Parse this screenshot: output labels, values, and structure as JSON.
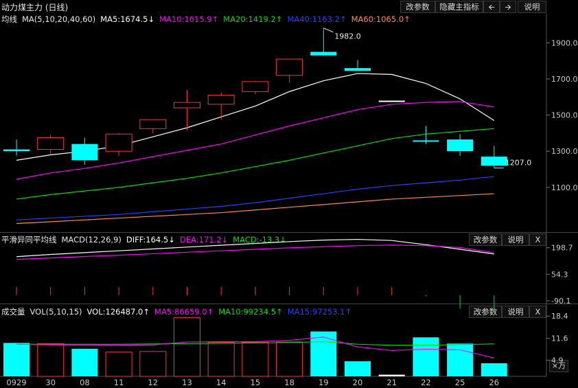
{
  "window": {
    "title": "动力煤主力 (日线)"
  },
  "toolbar": {
    "change_params": "改参数",
    "hide_indicator": "隐藏主指标",
    "prev_icon": "arrow-left-icon",
    "next_icon": "arrow-right-icon",
    "help": "说明"
  },
  "main_panel": {
    "label": "均线",
    "ma_spec": "MA(5,10,20,40,60)",
    "ma5": "MA5:1674.5↓",
    "ma10": "MA10:1615.9↑",
    "ma20": "MA20:1419.2↑",
    "ma40": "MA40:1163.2↑",
    "ma60": "MA60:1065.0↑",
    "high_note": "1982.0",
    "low_note": "1207.0",
    "yticks": [
      "1900.0",
      "1700.0",
      "1500.0",
      "1300.0",
      "1100.0"
    ]
  },
  "macd_panel": {
    "label": "平滑异同平均线",
    "spec": "MACD(12,26,9)",
    "diff": "DIFF:164.5↓",
    "dea": "DEA:171.2↓",
    "macd": "MACD:-13.3↓",
    "change_params": "改参数",
    "help": "说明",
    "close": "X",
    "yticks": [
      "198.7",
      "54.3",
      "-90.1"
    ]
  },
  "vol_panel": {
    "label": "成交量",
    "spec": "VOL(5,10,15)",
    "vol": "VOL:126487.0↑",
    "ma5": "MA5:86659.0↑",
    "ma10": "MA10:99234.5↑",
    "ma15": "MA15:97253.1↑",
    "change_params": "改参数",
    "help": "说明",
    "close": "X",
    "yticks": [
      "18.4",
      "11.6",
      "4.9"
    ],
    "unit": "×万"
  },
  "colors": {
    "up": "#ff3232",
    "down": "#00ffff",
    "flat": "#ffffff",
    "ma5": "#ffffff",
    "ma10": "#ff00ff",
    "ma20": "#00e000",
    "ma40": "#2244ff",
    "ma60": "#ff8c3c",
    "dea": "#ff00ff",
    "macd_ma15": "#2244ff"
  },
  "chart_data": {
    "type": "candlestick",
    "x_dates": [
      "0929",
      "30",
      "08",
      "11",
      "12",
      "13",
      "14",
      "15",
      "18",
      "19",
      "20",
      "21",
      "22",
      "25",
      "26"
    ],
    "candles": [
      {
        "open": 1310,
        "close": 1300,
        "high": 1365,
        "low": 1275
      },
      {
        "open": 1310,
        "close": 1375,
        "high": 1390,
        "low": 1285
      },
      {
        "open": 1340,
        "close": 1250,
        "high": 1375,
        "low": 1225
      },
      {
        "open": 1300,
        "close": 1395,
        "high": 1400,
        "low": 1275
      },
      {
        "open": 1425,
        "close": 1475,
        "high": 1475,
        "low": 1400
      },
      {
        "open": 1540,
        "close": 1570,
        "high": 1640,
        "low": 1415
      },
      {
        "open": 1560,
        "close": 1610,
        "high": 1625,
        "low": 1475
      },
      {
        "open": 1630,
        "close": 1685,
        "high": 1690,
        "low": 1615
      },
      {
        "open": 1720,
        "close": 1810,
        "high": 1810,
        "low": 1680
      },
      {
        "open": 1850,
        "close": 1830,
        "high": 1982,
        "low": 1830
      },
      {
        "open": 1760,
        "close": 1745,
        "high": 1805,
        "low": 1745
      },
      {
        "open": 1580,
        "close": 1580,
        "high": 1580,
        "low": 1580
      },
      {
        "open": 1360,
        "close": 1355,
        "high": 1440,
        "low": 1340
      },
      {
        "open": 1365,
        "close": 1300,
        "high": 1395,
        "low": 1275
      },
      {
        "open": 1270,
        "close": 1220,
        "high": 1330,
        "low": 1207
      }
    ],
    "ma": {
      "ma5": [
        1250,
        1280,
        1300,
        1330,
        1380,
        1430,
        1490,
        1550,
        1630,
        1690,
        1730,
        1725,
        1675,
        1590,
        1470
      ],
      "ma10": [
        1145,
        1180,
        1205,
        1235,
        1270,
        1305,
        1340,
        1390,
        1440,
        1485,
        1530,
        1560,
        1570,
        1575,
        1545
      ],
      "ma20": [
        1035,
        1060,
        1080,
        1100,
        1125,
        1150,
        1180,
        1215,
        1250,
        1290,
        1330,
        1370,
        1395,
        1410,
        1425
      ],
      "ma40": [
        920,
        930,
        940,
        950,
        965,
        980,
        995,
        1015,
        1040,
        1065,
        1090,
        1110,
        1125,
        1140,
        1160
      ],
      "ma60": [
        900,
        910,
        920,
        930,
        940,
        950,
        960,
        975,
        990,
        1005,
        1020,
        1035,
        1045,
        1055,
        1065
      ]
    },
    "y_range": [
      860,
      2000
    ],
    "macd": {
      "diff": [
        150,
        162,
        172,
        182,
        192,
        202,
        212,
        222,
        232,
        240,
        244,
        238,
        215,
        190,
        164.5
      ],
      "dea": [
        135,
        143,
        151,
        158,
        166,
        174,
        182,
        190,
        198,
        204,
        210,
        213,
        210,
        200,
        171.2
      ],
      "bar": [
        30,
        30,
        30,
        30,
        30,
        30,
        30,
        30,
        30,
        30,
        30,
        25,
        -5,
        -70,
        -90
      ],
      "y_range": [
        -90.1,
        220
      ]
    },
    "volume": {
      "values": [
        10.2,
        10.0,
        8.4,
        7.4,
        7.6,
        17.9,
        10.4,
        10.4,
        10.5,
        13.7,
        4.6,
        0.5,
        11.9,
        10.0,
        4.0
      ],
      "ma5": [
        9.8,
        9.6,
        9.6,
        9.5,
        9.6,
        10.5,
        10.6,
        10.6,
        11.0,
        12.0,
        9.0,
        7.9,
        8.3,
        8.1,
        5.6
      ],
      "ma10": [
        9.8,
        9.8,
        9.8,
        9.8,
        9.9,
        10.0,
        10.1,
        10.2,
        10.3,
        10.6,
        9.8,
        9.5,
        9.5,
        9.7,
        9.9
      ],
      "y_range": [
        0,
        19.5
      ]
    }
  }
}
